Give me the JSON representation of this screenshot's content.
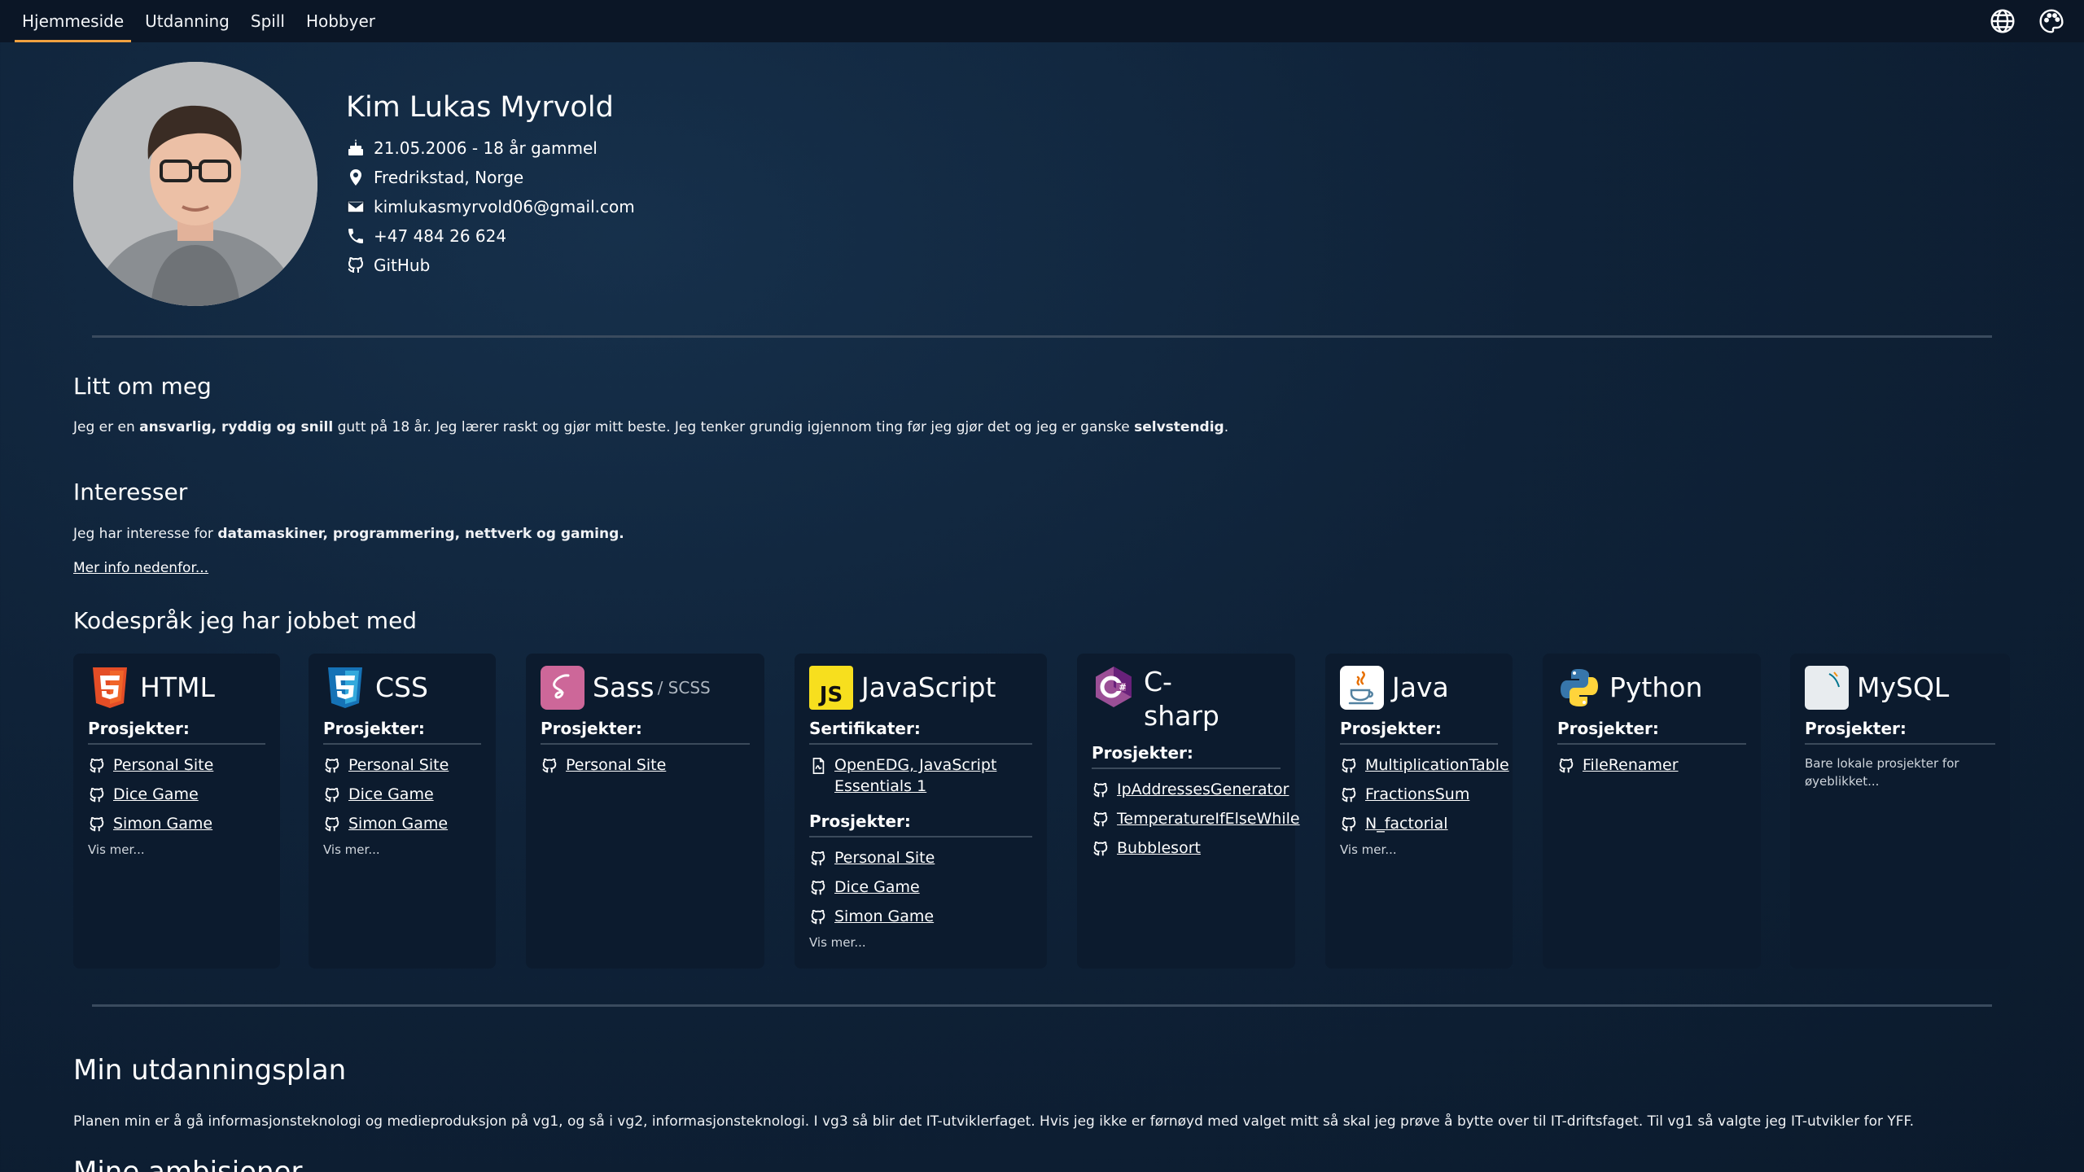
{
  "nav": {
    "tabs": [
      {
        "label": "Hjemmeside",
        "active": true
      },
      {
        "label": "Utdanning"
      },
      {
        "label": "Spill"
      },
      {
        "label": "Hobbyer"
      }
    ],
    "icons": [
      "globe-icon",
      "palette-icon"
    ]
  },
  "profile": {
    "name": "Kim Lukas Myrvold",
    "birth": "21.05.2006 - 18 år gammel",
    "location": "Fredrikstad, Norge",
    "email": "kimlukasmyrvold06@gmail.com",
    "phone": "+47 484 26 624",
    "github": "GitHub"
  },
  "about": {
    "title": "Litt om meg",
    "p1": "Jeg er en ",
    "b1": "ansvarlig, ryddig og snill",
    "p2": " gutt på 18 år. Jeg lærer raskt og gjør mitt beste. Jeg tenker grundig igjennom ting før jeg gjør det og jeg er ganske ",
    "b2": "selvstendig",
    "p3": "."
  },
  "interests": {
    "title": "Interesser",
    "p1": "Jeg har interesse for ",
    "b1": "datamaskiner, programmering, nettverk og gaming.",
    "link": "Mer info nedenfor..."
  },
  "languages": {
    "title": "Kodespråk jeg har jobbet med",
    "projects_label": "Prosjekter:",
    "certs_label": "Sertifikater:",
    "show_more": "Vis mer...",
    "html": {
      "name": "HTML",
      "projects": [
        "Personal Site",
        "Dice Game",
        "Simon Game"
      ]
    },
    "css": {
      "name": "CSS",
      "projects": [
        "Personal Site",
        "Dice Game",
        "Simon Game"
      ]
    },
    "sass": {
      "name": "Sass",
      "sub": "/ SCSS",
      "projects": [
        "Personal Site"
      ]
    },
    "js": {
      "name": "JavaScript",
      "certs": [
        "OpenEDG, JavaScript Essentials 1"
      ],
      "projects": [
        "Personal Site",
        "Dice Game",
        "Simon Game"
      ]
    },
    "csharp": {
      "name1": "C-",
      "name2": "sharp",
      "projects": [
        "IpAddressesGenerator",
        "TemperatureIfElseWhile",
        "Bubblesort"
      ]
    },
    "java": {
      "name": "Java",
      "projects": [
        "MultiplicationTable",
        "FractionsSum",
        "N_factorial"
      ]
    },
    "python": {
      "name": "Python",
      "projects": [
        "FileRenamer"
      ]
    },
    "mysql": {
      "name": "MySQL",
      "note": "Bare lokale prosjekter for øyeblikket..."
    }
  },
  "education": {
    "title": "Min utdanningsplan",
    "text": "Planen min er å gå informasjonsteknologi og medieproduksjon på vg1, og så i vg2, informasjonsteknologi. I vg3 så blir det IT-utviklerfaget. Hvis jeg ikke er førnøyd med valget mitt så skal jeg prøve å bytte over til IT-driftsfaget. Til vg1 så valgte jeg IT-utvikler for YFF."
  },
  "ambitions": {
    "title": "Mine ambisjoner"
  },
  "colors": {
    "accent": "#f0a040",
    "background": "#0f2238",
    "card": "#0c1b2e"
  }
}
